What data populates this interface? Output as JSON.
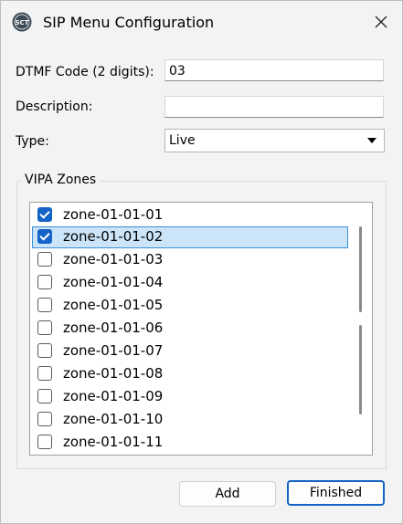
{
  "window": {
    "title": "SIP Menu Configuration",
    "app_icon_text": "SCT"
  },
  "form": {
    "dtmf_label": "DTMF Code (2 digits):",
    "dtmf_value": "03",
    "description_label": "Description:",
    "description_value": "",
    "type_label": "Type:",
    "type_value": "Live"
  },
  "zones": {
    "group_title": "VIPA Zones",
    "items": [
      {
        "label": "zone-01-01-01",
        "checked": true,
        "selected": false
      },
      {
        "label": "zone-01-01-02",
        "checked": true,
        "selected": true
      },
      {
        "label": "zone-01-01-03",
        "checked": false,
        "selected": false
      },
      {
        "label": "zone-01-01-04",
        "checked": false,
        "selected": false
      },
      {
        "label": "zone-01-01-05",
        "checked": false,
        "selected": false
      },
      {
        "label": "zone-01-01-06",
        "checked": false,
        "selected": false
      },
      {
        "label": "zone-01-01-07",
        "checked": false,
        "selected": false
      },
      {
        "label": "zone-01-01-08",
        "checked": false,
        "selected": false
      },
      {
        "label": "zone-01-01-09",
        "checked": false,
        "selected": false
      },
      {
        "label": "zone-01-01-10",
        "checked": false,
        "selected": false
      },
      {
        "label": "zone-01-01-11",
        "checked": false,
        "selected": false
      }
    ]
  },
  "buttons": {
    "add_label": "Add",
    "finished_label": "Finished"
  },
  "icons": {
    "app": "sct-logo-icon",
    "close": "close-icon",
    "dropdown": "chevron-down-icon"
  },
  "colors": {
    "accent": "#1464c8",
    "selection": "#cce4f7",
    "background": "#f3f3f3"
  }
}
